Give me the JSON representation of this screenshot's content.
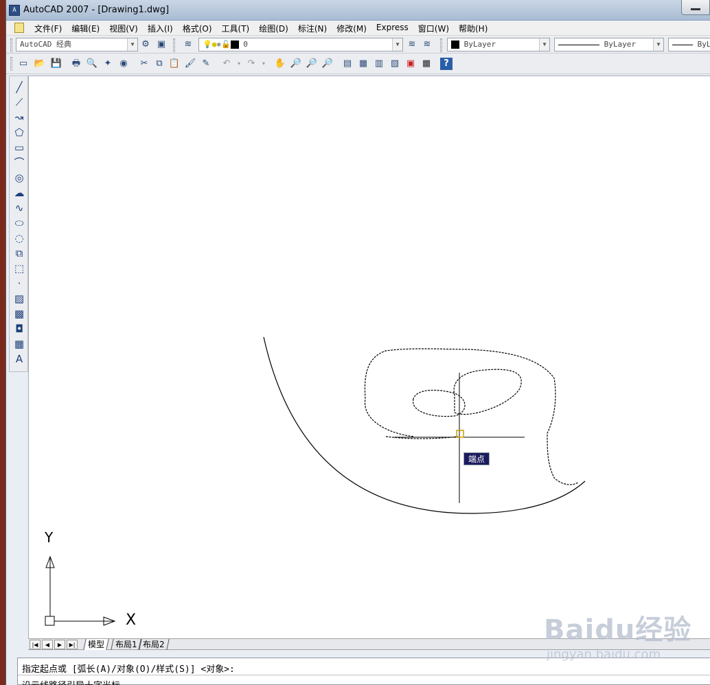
{
  "window": {
    "title": "AutoCAD 2007 - [Drawing1.dwg]",
    "app_icon_text": "A"
  },
  "menu": [
    "文件(F)",
    "编辑(E)",
    "视图(V)",
    "插入(I)",
    "格式(O)",
    "工具(T)",
    "绘图(D)",
    "标注(N)",
    "修改(M)",
    "Express",
    "窗口(W)",
    "帮助(H)"
  ],
  "toolbar": {
    "workspace": "AutoCAD 经典",
    "layer": "0",
    "color": "ByLayer",
    "linetype": "ByLayer",
    "lineweight": "ByL"
  },
  "layout_tabs": [
    "模型",
    "布局1",
    "布局2"
  ],
  "tooltip": "端点",
  "ucs": {
    "x_label": "X",
    "y_label": "Y"
  },
  "command": {
    "line1": "指定起点或 [弧长(A)/对象(O)/样式(S)] <对象>:",
    "line2": "沿云线路径引导十字光标..."
  },
  "watermark": {
    "brand": "Baidu经验",
    "url": "jingyan.baidu.com"
  }
}
